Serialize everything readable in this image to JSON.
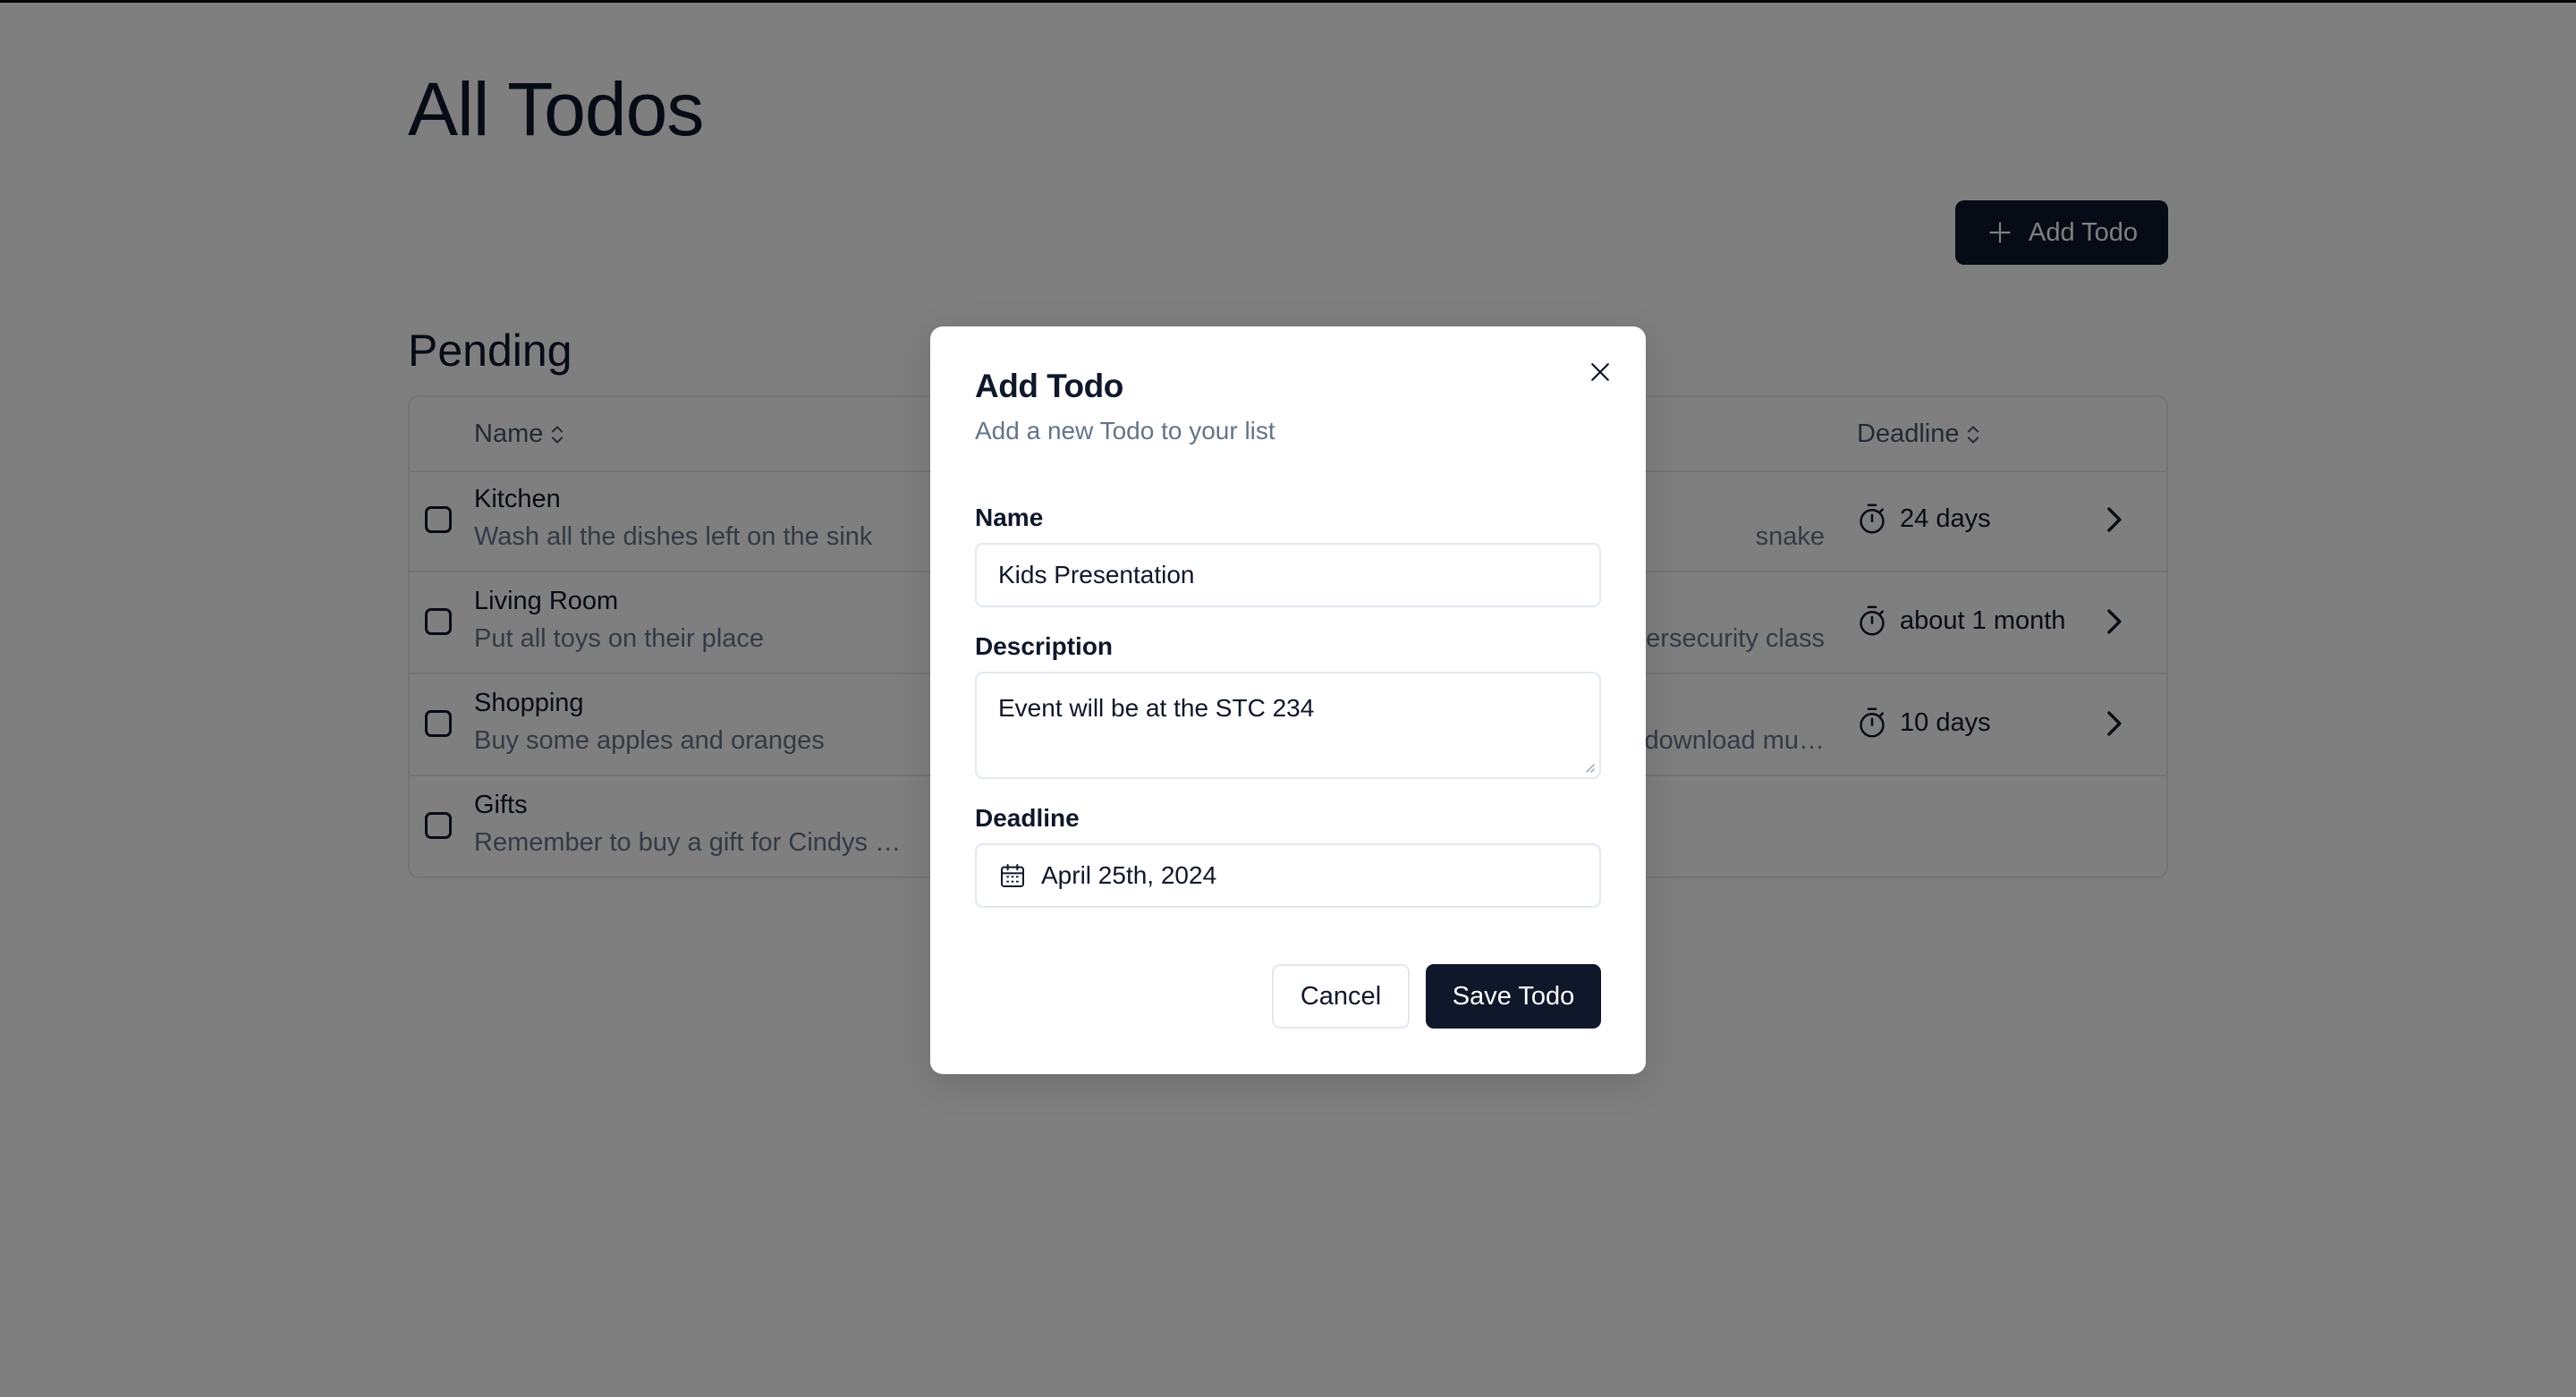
{
  "page": {
    "title": "All Todos",
    "add_button_label": "Add Todo",
    "section_title": "Pending"
  },
  "table": {
    "headers": {
      "name": "Name",
      "deadline": "Deadline"
    },
    "rows": [
      {
        "title": "Kitchen",
        "description": "Wash all the dishes left on the sink",
        "description_right": "snake",
        "deadline": "24 days",
        "has_deadline": true
      },
      {
        "title": "Living Room",
        "description": "Put all toys on their place",
        "description_right": "persecurity class",
        "deadline": "about 1 month",
        "has_deadline": true
      },
      {
        "title": "Shopping",
        "description": "Buy some apples and oranges",
        "description_right": "download mu…",
        "deadline": "10 days",
        "has_deadline": true
      },
      {
        "title": "Gifts",
        "description": "Remember to buy a gift for Cindys bi…",
        "description_right": "",
        "deadline": "",
        "has_deadline": false
      }
    ]
  },
  "modal": {
    "title": "Add Todo",
    "subtitle": "Add a new Todo to your list",
    "name_label": "Name",
    "name_value": "Kids Presentation",
    "description_label": "Description",
    "description_value": "Event will be at the STC 234",
    "deadline_label": "Deadline",
    "deadline_value": "April 25th, 2024",
    "cancel_label": "Cancel",
    "save_label": "Save Todo"
  },
  "colors": {
    "primary": "#0f172a",
    "muted_text": "#64748b",
    "border": "#e2e8f0",
    "overlay": "rgba(0,0,0,0.5)"
  },
  "icons": {
    "add": "plus-icon",
    "sort": "sort-icon",
    "timer": "timer-icon",
    "row_open": "chevron-right-icon",
    "close": "close-icon",
    "calendar": "calendar-icon"
  }
}
